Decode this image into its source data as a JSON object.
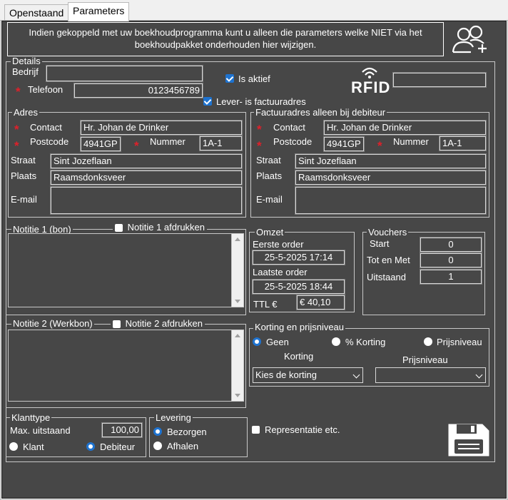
{
  "tabs": [
    {
      "label": "Openstaand"
    },
    {
      "label": "Parameters"
    }
  ],
  "info_text_line1": "Indien gekoppeld met uw boekhoudprogramma kunt u alleen  die parameters welke NIET via het",
  "info_text_line2": "boekhoudpakket onderhouden hier wijzigen.",
  "details": {
    "title": "Details",
    "bedrijf_label": "Bedrijf",
    "bedrijf_value": "",
    "telefoon_label": "Telefoon",
    "telefoon_value": "0123456789",
    "is_aktief_label": "Is aktief",
    "lever_label": "Lever- is factuuradres",
    "rfid_label": "RFID",
    "rfid_value": ""
  },
  "adres": {
    "title": "Adres",
    "contact_label": "Contact",
    "contact_value": "Hr. Johan de Drinker",
    "postcode_label": "Postcode",
    "postcode_value": "4941GP",
    "nummer_label": "Nummer",
    "nummer_value": "1A-1",
    "straat_label": "Straat",
    "straat_value": "Sint Jozeflaan",
    "plaats_label": "Plaats",
    "plaats_value": "Raamsdonksveer",
    "email_label": "E-mail",
    "email_value": ""
  },
  "factuuradres": {
    "title": "Factuuradres alleen bij debiteur",
    "contact_label": "Contact",
    "contact_value": "Hr. Johan de Drinker",
    "postcode_label": "Postcode",
    "postcode_value": "4941GP",
    "nummer_label": "Nummer",
    "nummer_value": "1A-1",
    "straat_label": "Straat",
    "straat_value": "Sint Jozeflaan",
    "plaats_label": "Plaats",
    "plaats_value": "Raamsdonksveer",
    "email_label": "E-mail",
    "email_value": ""
  },
  "notitie1": {
    "title": "Notitie 1 (bon)",
    "print_label": "Notitie 1 afdrukken"
  },
  "notitie2": {
    "title": "Notitie 2 (Werkbon)",
    "print_label": "Notitie 2 afdrukken"
  },
  "omzet": {
    "title": "Omzet",
    "eerste_label": "Eerste order",
    "eerste_value": "25-5-2025 17:14",
    "laatste_label": "Laatste order",
    "laatste_value": "25-5-2025 18:44",
    "ttl_label": "TTL €",
    "ttl_value": "€ 40,10"
  },
  "vouchers": {
    "title": "Vouchers",
    "start_label": "Start",
    "start_value": "0",
    "totenmet_label": "Tot en Met",
    "totenmet_value": "0",
    "uitstaand_label": "Uitstaand",
    "uitstaand_value": "1"
  },
  "korting": {
    "title": "Korting en prijsniveau",
    "geen_label": "Geen",
    "pct_label": "% Korting",
    "prijsniveau_label": "Prijsniveau",
    "korting_caption": "Korting",
    "prijsniveau_caption": "Prijsniveau",
    "korting_select": "Kies de korting",
    "prijsniveau_select": ""
  },
  "klanttype": {
    "title": "Klanttype",
    "max_label": "Max. uitstaand",
    "max_value": "100,00",
    "klant_label": "Klant",
    "debiteur_label": "Debiteur"
  },
  "levering": {
    "title": "Levering",
    "bezorgen_label": "Bezorgen",
    "afhalen_label": "Afhalen"
  },
  "representatie_label": "Representatie etc.",
  "icons": {
    "add_user": "add-user-icon",
    "save": "floppy-disk-icon",
    "rfid": "rfid-icon"
  }
}
